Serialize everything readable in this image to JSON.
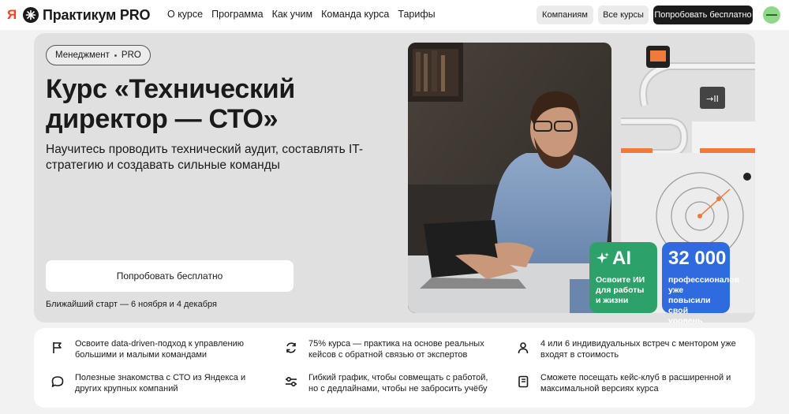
{
  "header": {
    "logo_ya": "Я",
    "brand": "Практикум PRO",
    "nav": [
      "О курсе",
      "Программа",
      "Как учим",
      "Команда курса",
      "Тарифы"
    ],
    "btn_companies": "Компаниям",
    "btn_all_courses": "Все курсы",
    "btn_try": "Попробовать бесплатно"
  },
  "hero": {
    "tag_left": "Менеджмент",
    "tag_right": "PRO",
    "title": "Курс «Технический директор — СТО»",
    "subtitle": "Научитесь проводить технический аудит, составлять IT-стратегию и создавать сильные команды",
    "cta": "Попробовать бесплатно",
    "start": "Ближайший старт — 6 ноября и 4 декабря"
  },
  "badges": {
    "ai_big": "AI",
    "ai_small": "Освоите ИИ для работы и жизни",
    "num_big": "32 000",
    "num_small": "профессионалов уже повысили свой уровень"
  },
  "features": [
    {
      "icon": "flag-icon",
      "text": "Освоите data-driven-подход к управлению большими и малыми командами"
    },
    {
      "icon": "refresh-icon",
      "text": "75% курса — практика на основе реальных кейсов с обратной связью от экспертов"
    },
    {
      "icon": "person-icon",
      "text": "4 или 6 индивидуальных встреч с ментором уже входят в стоимость"
    },
    {
      "icon": "chat-icon",
      "text": "Полезные знакомства с СТО из Яндекса и других крупных компаний"
    },
    {
      "icon": "sliders-icon",
      "text": "Гибкий график, чтобы совмещать с работой, но с дедлайнами, чтобы не забросить учёбу"
    },
    {
      "icon": "book-icon",
      "text": "Сможете посещать кейс-клуб в расширенной и максимальной версиях курса"
    }
  ],
  "colors": {
    "accent_green": "#2ca26a",
    "accent_blue": "#2f6bdf",
    "accent_orange": "#f07a3a",
    "brand_red": "#fc3f1d"
  }
}
